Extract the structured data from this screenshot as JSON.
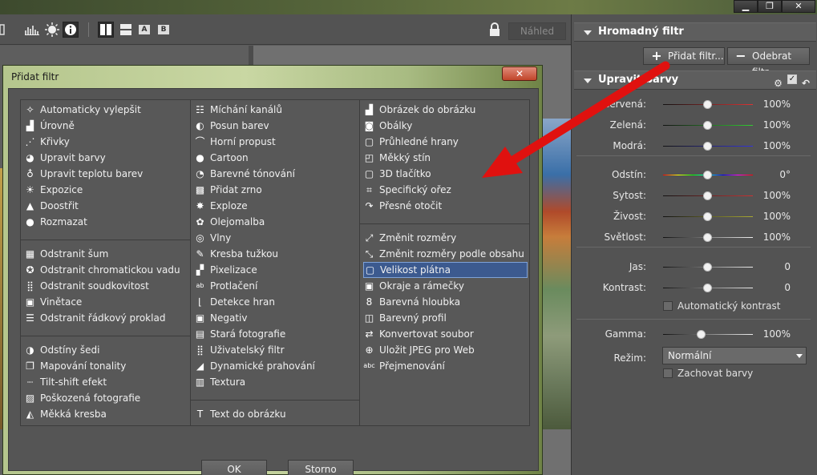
{
  "toolbar": {
    "preview_label": "Náhled",
    "letter_a": "A",
    "letter_b": "B"
  },
  "window": {
    "close": "✕",
    "restore": "❐",
    "minimize": "▁"
  },
  "panel": {
    "batch_title": "Hromadný filtr",
    "add_filter": "Přidat filtr...",
    "remove_filter": "Odebrat filtr",
    "adjust_title": "Upravit barvy",
    "sliders": [
      {
        "label": "Červená:",
        "value": "100%",
        "pos": 0.5,
        "color": "#d33"
      },
      {
        "label": "Zelená:",
        "value": "100%",
        "pos": 0.5,
        "color": "#3c3"
      },
      {
        "label": "Modrá:",
        "value": "100%",
        "pos": 0.5,
        "color": "#33d"
      },
      {
        "label": "Odstín:",
        "value": "0°",
        "pos": 0.5,
        "color": "rainbow"
      },
      {
        "label": "Sytost:",
        "value": "100%",
        "pos": 0.5,
        "color": "#c33"
      },
      {
        "label": "Živost:",
        "value": "100%",
        "pos": 0.5,
        "color": "#aa3"
      },
      {
        "label": "Světlost:",
        "value": "100%",
        "pos": 0.5,
        "color": "#eee"
      },
      {
        "label": "Jas:",
        "value": "0",
        "pos": 0.5,
        "color": "#eee"
      },
      {
        "label": "Kontrast:",
        "value": "0",
        "pos": 0.5,
        "color": "#eee"
      },
      {
        "label": "Gamma:",
        "value": "100%",
        "pos": 0.43,
        "color": "#eee"
      }
    ],
    "auto_contrast": "Automatický kontrast",
    "mode_label": "Režim:",
    "mode_value": "Normální",
    "keep_colors": "Zachovat barvy"
  },
  "dialog": {
    "title": "Přidat filtr",
    "close": "✕",
    "ok": "OK",
    "cancel": "Storno",
    "col1": [
      [
        "Automaticky vylepšit",
        "Úrovně",
        "Křivky",
        "Upravit barvy",
        "Upravit teplotu barev",
        "Expozice",
        "Doostřit",
        "Rozmazat"
      ],
      [
        "Odstranit šum",
        "Odstranit chromatickou vadu",
        "Odstranit soudkovitost",
        "Vinětace",
        "Odstranit řádkový proklad"
      ],
      [
        "Odstíny šedi",
        "Mapování tonality",
        "Tilt-shift efekt",
        "Poškozená fotografie",
        "Měkká kresba"
      ]
    ],
    "col2": [
      [
        "Míchání kanálů",
        "Posun barev",
        "Horní propust",
        "Cartoon",
        "Barevné tónování",
        "Přidat zrno",
        "Exploze",
        "Olejomalba",
        "Vlny",
        "Kresba tužkou",
        "Pixelizace",
        "Protlačení",
        "Detekce hran",
        "Negativ",
        "Stará fotografie",
        "Uživatelský filtr",
        "Dynamické prahování",
        "Textura"
      ],
      [
        "Text do obrázku"
      ]
    ],
    "col3": [
      [
        "Obrázek do obrázku",
        "Obálky",
        "Průhledné hrany",
        "Měkký stín",
        "3D tlačítko",
        "Specifický ořez",
        "Přesné otočit"
      ],
      [
        "Změnit rozměry",
        "Změnit rozměry podle obsahu",
        "Velikost plátna",
        "Okraje a rámečky",
        "Barevná hloubka",
        "Barevný profil",
        "Konvertovat soubor",
        "Uložit JPEG pro Web",
        "Přejmenování"
      ]
    ],
    "selected": "Velikost plátna"
  }
}
